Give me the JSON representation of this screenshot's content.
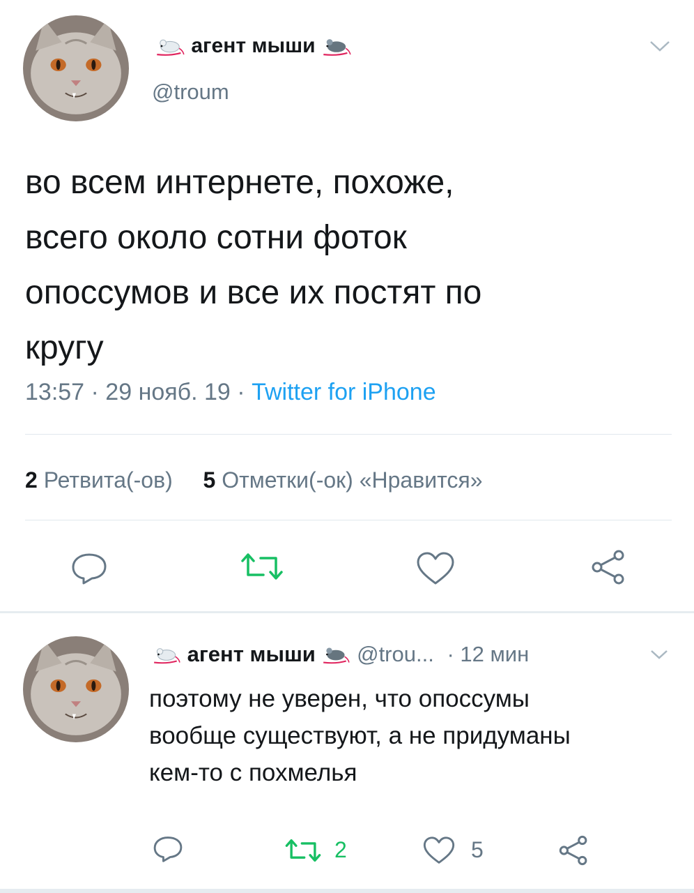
{
  "main_tweet": {
    "display_name": "агент мыши",
    "handle": "@troum",
    "text_lines": [
      "во всем интернете, похоже,",
      "всего около сотни фоток",
      "опоссумов и все их постят по",
      "кругу"
    ],
    "time": "13:57 · 29 нояб. 19 · ",
    "source": "Twitter for iPhone",
    "retweets_count": "2",
    "retweets_label": "Ретвита(-ов)",
    "likes_count": "5",
    "likes_label": "Отметки(-ок) «Нравится»"
  },
  "reply_tweet": {
    "display_name": "агент мыши",
    "handle": "@trou...",
    "age": "· 12 мин",
    "text_lines": [
      "поэтому не уверен, что опоссумы",
      "вообще существуют, а не придуманы",
      "кем-то с похмелья"
    ],
    "retweet_count": "2",
    "like_count": "5"
  },
  "icons": {
    "caret": "chevron-down-icon",
    "reply": "reply-icon",
    "retweet": "retweet-icon",
    "like": "heart-icon",
    "share": "share-icon",
    "emoji": "mouse-emoji-icon"
  },
  "colors": {
    "retweet_green": "#17bf63",
    "link_blue": "#1da1f2",
    "muted": "#657786",
    "divider": "#e1e8ed"
  }
}
